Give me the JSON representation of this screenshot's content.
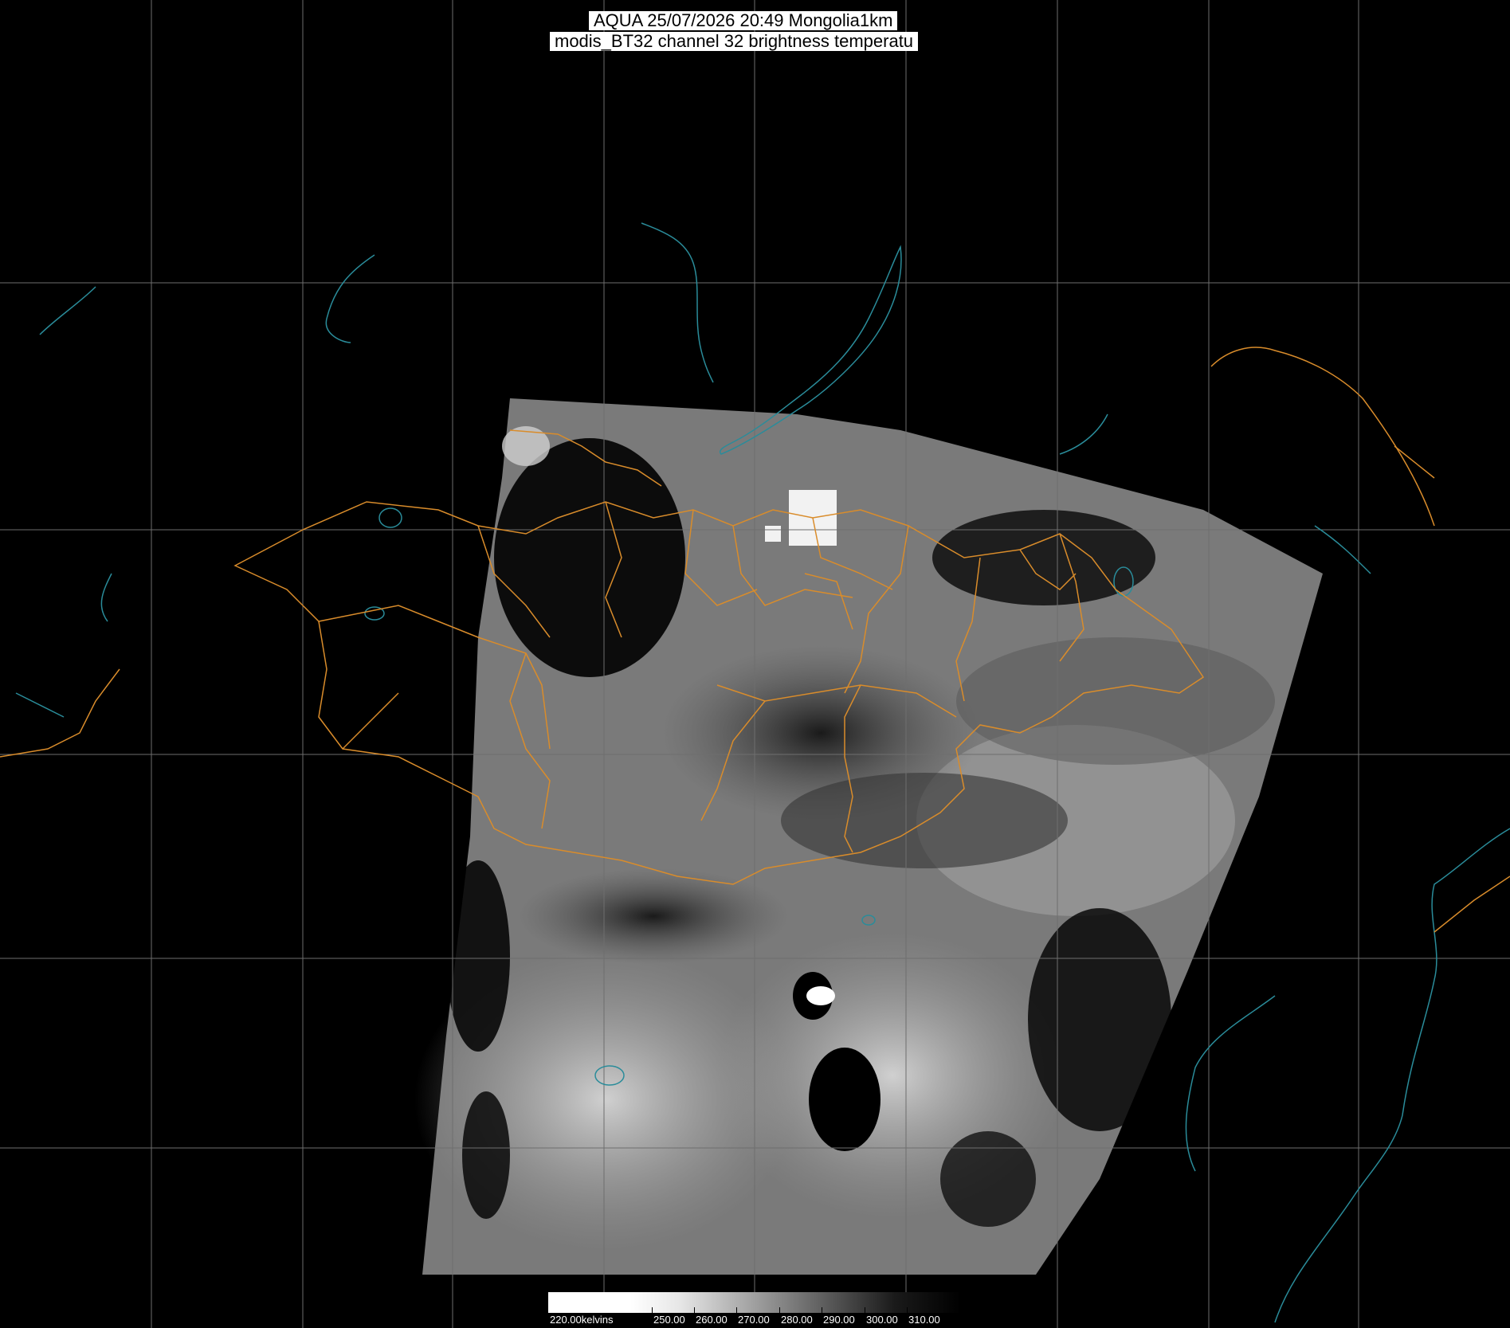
{
  "title": {
    "line1": "AQUA 25/07/2026 20:49 Mongolia1km",
    "line2": "modis_BT32 channel 32 brightness temperatu"
  },
  "colorbar": {
    "unit_label": "220.00kelvins",
    "tick_labels": [
      "250.00",
      "260.00",
      "270.00",
      "280.00",
      "290.00",
      "300.00",
      "310.00"
    ]
  },
  "colors": {
    "background": "#000000",
    "graticule": "#6e6e6e",
    "admin_boundaries": "#d98c2b",
    "coastlines_rivers": "#2a8c9a",
    "satellite_swath": "grayscale"
  }
}
